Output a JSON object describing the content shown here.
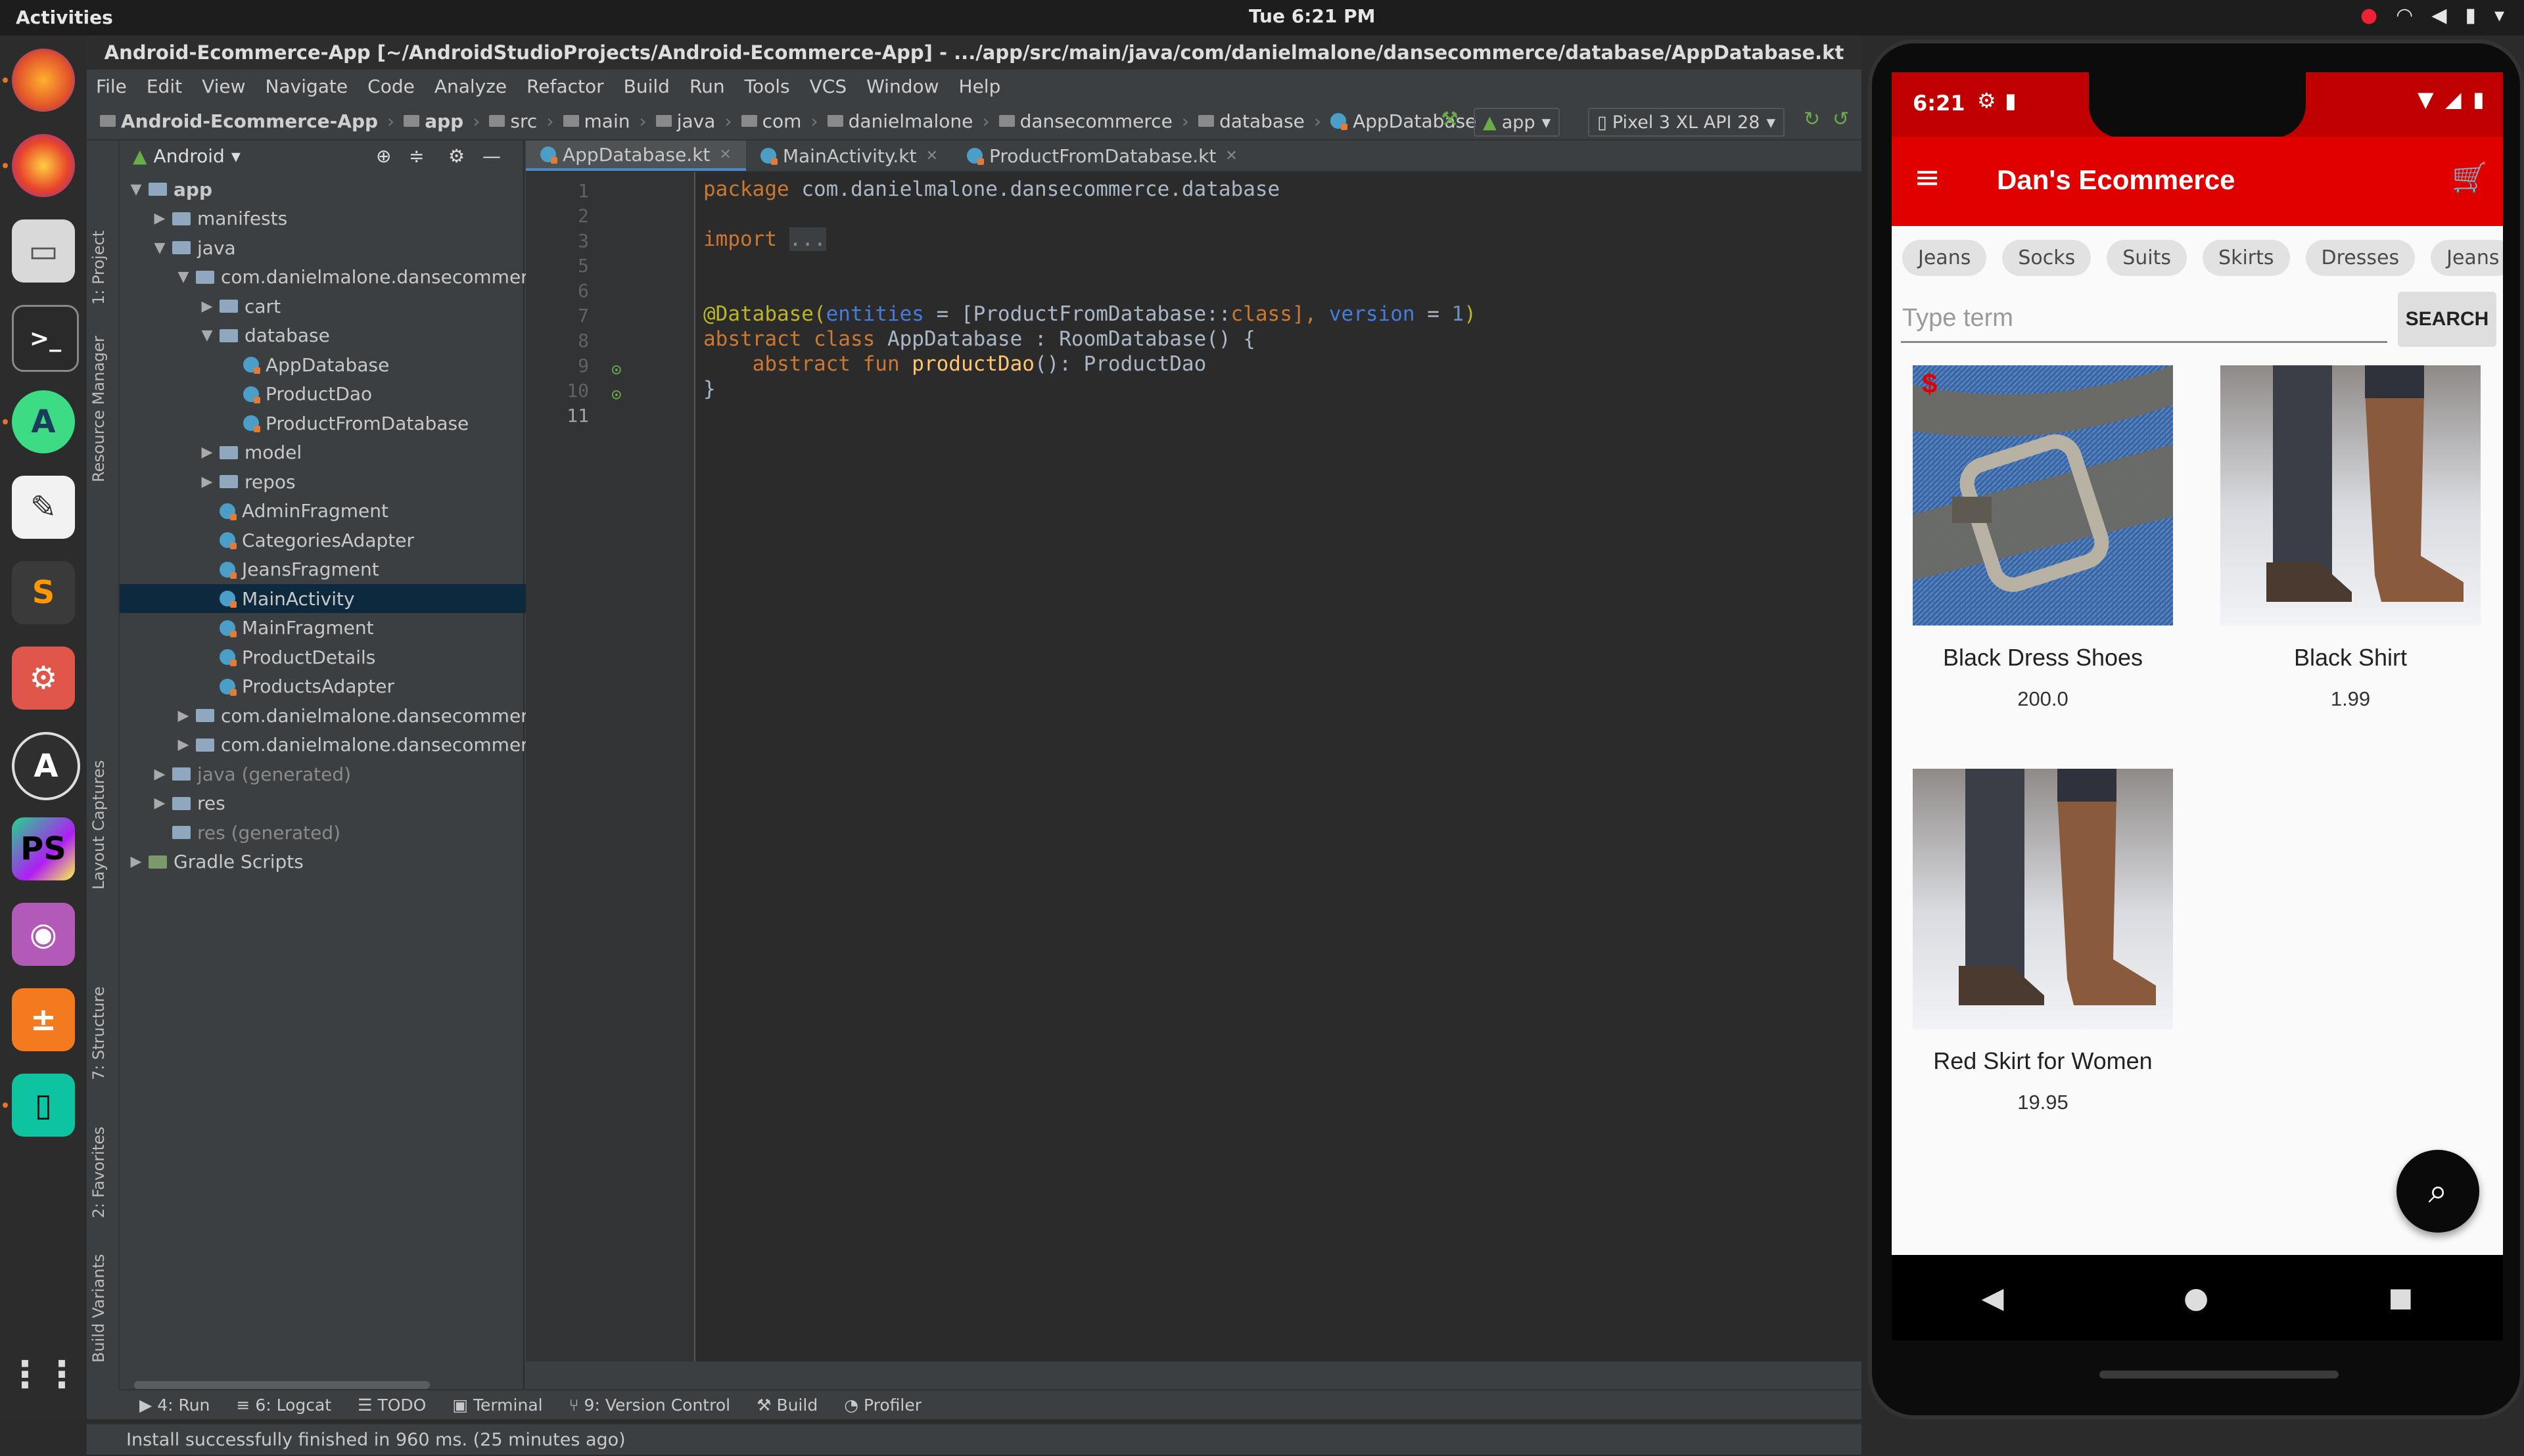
{
  "topbar": {
    "activities": "Activities",
    "clock": "Tue  6:21 PM"
  },
  "ide": {
    "window_title": "Android-Ecommerce-App [~/AndroidStudioProjects/Android-Ecommerce-App] - .../app/src/main/java/com/danielmalone/dansecommerce/database/AppDatabase.kt",
    "menu": [
      "File",
      "Edit",
      "View",
      "Navigate",
      "Code",
      "Analyze",
      "Refactor",
      "Build",
      "Run",
      "Tools",
      "VCS",
      "Window",
      "Help"
    ],
    "breadcrumbs": [
      "Android-Ecommerce-App",
      "app",
      "src",
      "main",
      "java",
      "com",
      "danielmalone",
      "dansecommerce",
      "database",
      "AppDatabase"
    ],
    "run_config": "app",
    "device": "Pixel 3 XL API 28",
    "project_view": "Android",
    "tree": [
      {
        "label": "app",
        "depth": 0,
        "type": "folder",
        "open": true
      },
      {
        "label": "manifests",
        "depth": 1,
        "type": "folder",
        "open": false
      },
      {
        "label": "java",
        "depth": 1,
        "type": "folder",
        "open": true
      },
      {
        "label": "com.danielmalone.dansecommerce",
        "depth": 2,
        "type": "folder",
        "open": true
      },
      {
        "label": "cart",
        "depth": 3,
        "type": "folder",
        "open": false
      },
      {
        "label": "database",
        "depth": 3,
        "type": "folder",
        "open": true
      },
      {
        "label": "AppDatabase",
        "depth": 4,
        "type": "file"
      },
      {
        "label": "ProductDao",
        "depth": 4,
        "type": "file"
      },
      {
        "label": "ProductFromDatabase",
        "depth": 4,
        "type": "file"
      },
      {
        "label": "model",
        "depth": 3,
        "type": "folder",
        "open": false
      },
      {
        "label": "repos",
        "depth": 3,
        "type": "folder",
        "open": false
      },
      {
        "label": "AdminFragment",
        "depth": 3,
        "type": "file"
      },
      {
        "label": "CategoriesAdapter",
        "depth": 3,
        "type": "file"
      },
      {
        "label": "JeansFragment",
        "depth": 3,
        "type": "file"
      },
      {
        "label": "MainActivity",
        "depth": 3,
        "type": "file",
        "selected": true
      },
      {
        "label": "MainFragment",
        "depth": 3,
        "type": "file"
      },
      {
        "label": "ProductDetails",
        "depth": 3,
        "type": "file"
      },
      {
        "label": "ProductsAdapter",
        "depth": 3,
        "type": "file"
      },
      {
        "label": "com.danielmalone.dansecommerce",
        "depth": 2,
        "type": "folder",
        "open": false
      },
      {
        "label": "com.danielmalone.dansecommerce",
        "depth": 2,
        "type": "folder",
        "open": false
      },
      {
        "label": "java (generated)",
        "depth": 1,
        "type": "folder",
        "open": false
      },
      {
        "label": "res",
        "depth": 1,
        "type": "folder",
        "open": false
      },
      {
        "label": "res (generated)",
        "depth": 1,
        "type": "folder",
        "open": null
      },
      {
        "label": "Gradle Scripts",
        "depth": 0,
        "type": "gradle",
        "open": false
      }
    ],
    "editor_tabs": [
      "AppDatabase.kt",
      "MainActivity.kt",
      "ProductFromDatabase.kt"
    ],
    "side_tabs": [
      "1: Project",
      "Resource Manager",
      "Layout Captures",
      "7: Structure",
      "2: Favorites",
      "Build Variants"
    ],
    "bottom_tools": [
      "4: Run",
      "6: Logcat",
      "TODO",
      "Terminal",
      "9: Version Control",
      "Build",
      "Profiler"
    ],
    "status": "Install successfully finished in 960 ms. (25 minutes ago)"
  },
  "code": {
    "line_numbers": [
      "1",
      "2",
      "3",
      "5",
      "6",
      "7",
      "8",
      "9",
      "10",
      "11"
    ],
    "line1": {
      "kw": "package",
      "rest": " com.danielmalone.dansecommerce.database"
    },
    "line3": {
      "kw": "import",
      "fold": "..."
    },
    "line7": {
      "ann": "@Database(",
      "p1": "entities",
      "eq1": " = [ProductFromDatabase::",
      "cls": "class",
      "mid": "], ",
      "p2": "version",
      "eq2": " = ",
      "num": "1",
      "end": ")"
    },
    "line8": {
      "kw": "abstract class",
      "rest": " AppDatabase : RoomDatabase() {"
    },
    "line9": {
      "kw": "abstract fun",
      "fn": " productDao",
      "rest": "(): ProductDao"
    },
    "line10": "}"
  },
  "phone": {
    "time": "6:21",
    "app_title": "Dan's Ecommerce",
    "categories": [
      "Jeans",
      "Socks",
      "Suits",
      "Skirts",
      "Dresses",
      "Jeans"
    ],
    "search_placeholder": "Type term",
    "search_button": "SEARCH",
    "products": [
      {
        "name": "Black Dress Shoes",
        "price": "200.0",
        "image": "belt-on-jeans"
      },
      {
        "name": "Black Shirt",
        "price": "1.99",
        "image": "brown-boots-snow"
      },
      {
        "name": "Red Skirt for Women",
        "price": "19.95",
        "image": "brown-boots-snow"
      }
    ],
    "accent": "#e00000"
  }
}
